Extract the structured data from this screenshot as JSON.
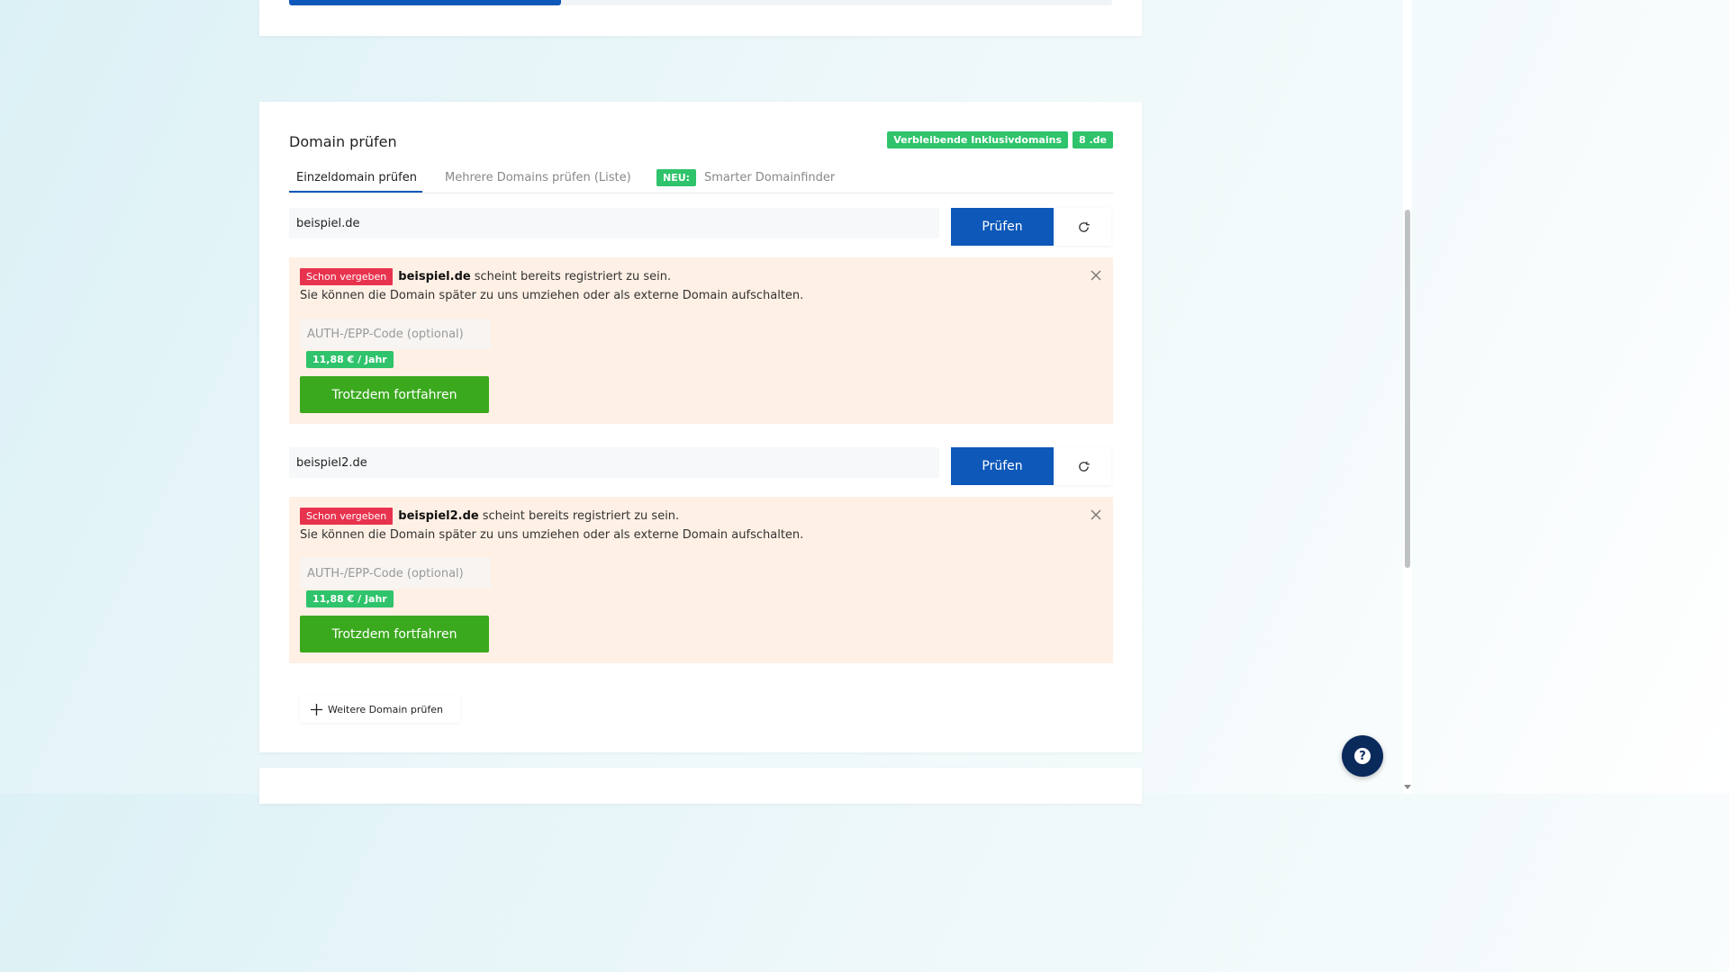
{
  "top_progress": {
    "fraction": 0.33
  },
  "domain_check": {
    "title": "Domain prüfen",
    "quota_label": "Verbleibende Inklusivdomains",
    "quota_value": "8 .de",
    "tabs": [
      {
        "label": "Einzeldomain prüfen",
        "active": true
      },
      {
        "label": "Mehrere Domains prüfen (Liste)",
        "active": false
      },
      {
        "badge": "NEU:",
        "label": "Smarter Domainfinder",
        "active": false
      }
    ],
    "check_button_label": "Prüfen",
    "rows": [
      {
        "input_value": "beispiel.de",
        "status_badge": "Schon vergeben",
        "domain": "beispiel.de",
        "message": "scheint bereits registriert zu sein.",
        "hint": "Sie können die Domain später zu uns umziehen oder als externe Domain aufschalten.",
        "auth_placeholder": "AUTH-/EPP-Code (optional)",
        "price": "11,88 € / Jahr",
        "continue_label": "Trotzdem fortfahren"
      },
      {
        "input_value": "beispiel2.de",
        "status_badge": "Schon vergeben",
        "domain": "beispiel2.de",
        "message": "scheint bereits registriert zu sein.",
        "hint": "Sie können die Domain später zu uns umziehen oder als externe Domain aufschalten.",
        "auth_placeholder": "AUTH-/EPP-Code (optional)",
        "price": "11,88 € / Jahr",
        "continue_label": "Trotzdem fortfahren"
      }
    ],
    "add_domain_label": "Weitere Domain prüfen"
  },
  "icons": {
    "reset": "refresh-icon",
    "close": "close-icon",
    "add": "plus-icon",
    "help": "question-icon"
  },
  "colors": {
    "primary": "#0d58b9",
    "success": "#3ba91e",
    "badge_green": "#2fc36b",
    "danger": "#e8334e",
    "result_bg": "#fff0e5"
  },
  "help": {
    "glyph": "?"
  }
}
